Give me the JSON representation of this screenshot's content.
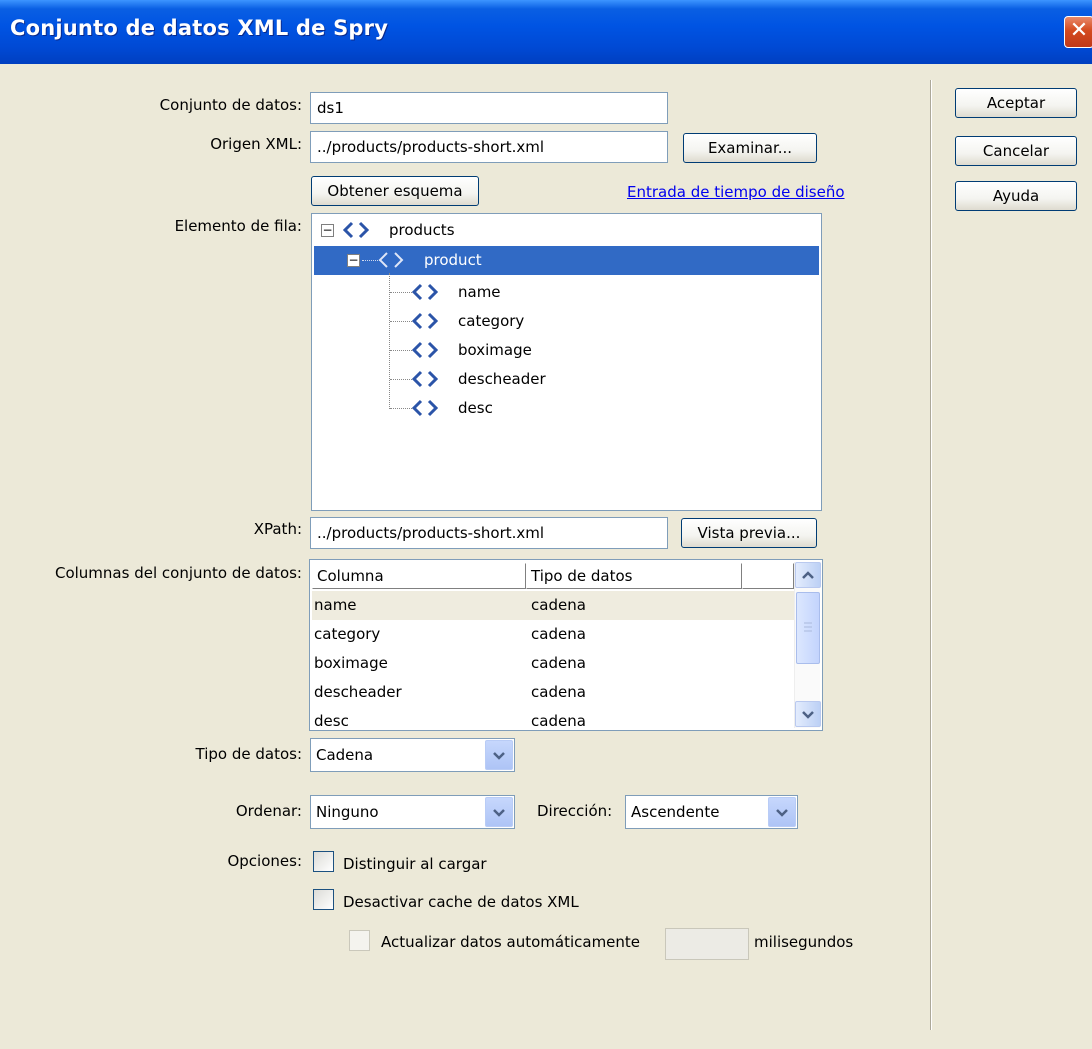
{
  "window": {
    "title": "Conjunto de datos XML de Spry",
    "close_glyph": "✕"
  },
  "buttons": {
    "ok": "Aceptar",
    "cancel": "Cancelar",
    "help": "Ayuda",
    "browse": "Examinar...",
    "get_schema": "Obtener esquema",
    "preview": "Vista previa..."
  },
  "form": {
    "dataset_label": "Conjunto de datos:",
    "dataset_value": "ds1",
    "xml_source_label": "Origen XML:",
    "xml_source_value": "../products/products-short.xml",
    "design_time_link": "Entrada de tiempo de diseño",
    "row_element_label": "Elemento de fila:",
    "xpath_label": "XPath:",
    "xpath_value": "../products/products-short.xml",
    "columns_label": "Columnas del conjunto de datos:",
    "data_type_label": "Tipo de datos:",
    "data_type_value": "Cadena",
    "sort_label": "Ordenar:",
    "sort_value": "Ninguno",
    "direction_label": "Dirección:",
    "direction_value": "Ascendente",
    "options_label": "Opciones:",
    "opt_distinct": "Distinguir al cargar",
    "opt_disable_cache": "Desactivar cache de datos XML",
    "opt_auto_refresh": "Actualizar datos automáticamente",
    "refresh_value": "",
    "refresh_unit": "milisegundos"
  },
  "tree": {
    "root": "products",
    "selected": "product",
    "children": [
      "name",
      "category",
      "boximage",
      "descheader",
      "desc"
    ]
  },
  "grid": {
    "headers": [
      "Columna",
      "Tipo de datos"
    ],
    "rows": [
      [
        "name",
        "cadena"
      ],
      [
        "category",
        "cadena"
      ],
      [
        "boximage",
        "cadena"
      ],
      [
        "descheader",
        "cadena"
      ],
      [
        "desc",
        "cadena"
      ]
    ]
  },
  "colors": {
    "titlebar": "#0054e3",
    "selection": "#316ac5",
    "dialog_bg": "#ECE9D8",
    "link": "#0000ee"
  },
  "icons": [
    "close-icon",
    "xml-tag-icon",
    "collapse-icon",
    "dropdown-arrow-icon",
    "scroll-up-icon",
    "scroll-down-icon"
  ]
}
